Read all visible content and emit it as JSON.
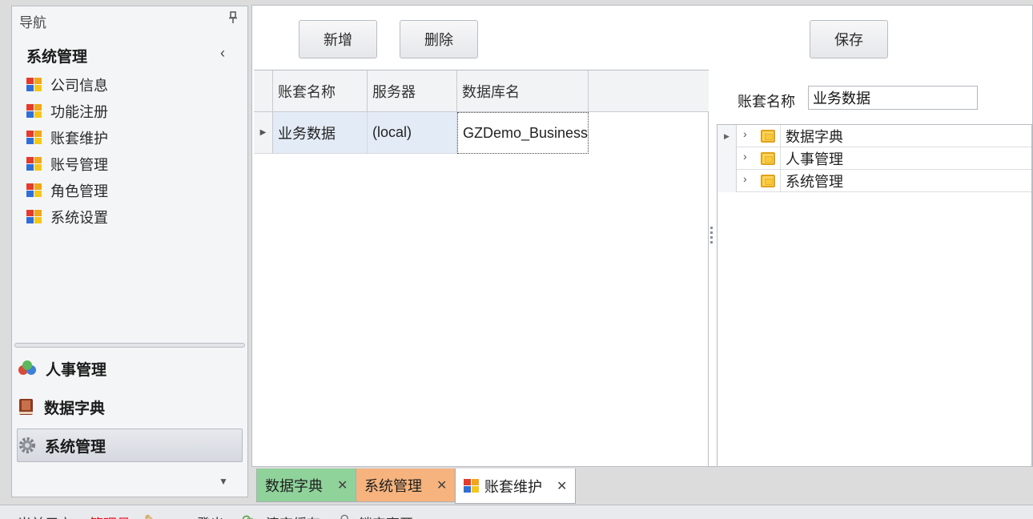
{
  "nav": {
    "title": "导航",
    "group_title": "系统管理",
    "items": [
      {
        "label": "公司信息"
      },
      {
        "label": "功能注册"
      },
      {
        "label": "账套维护"
      },
      {
        "label": "账号管理"
      },
      {
        "label": "角色管理"
      },
      {
        "label": "系统设置"
      }
    ],
    "groups": [
      {
        "label": "人事管理",
        "icon": "people-icon"
      },
      {
        "label": "数据字典",
        "icon": "book-icon"
      },
      {
        "label": "系统管理",
        "icon": "gear-icon",
        "active": true
      }
    ]
  },
  "toolbar": {
    "add_label": "新增",
    "delete_label": "删除",
    "save_label": "保存"
  },
  "grid": {
    "columns": [
      "账套名称",
      "服务器",
      "数据库名"
    ],
    "rows": [
      {
        "name": "业务数据",
        "server": "(local)",
        "database": "GZDemo_Business"
      }
    ]
  },
  "detail": {
    "name_label": "账套名称",
    "name_value": "业务数据",
    "tree": [
      "数据字典",
      "人事管理",
      "系统管理"
    ]
  },
  "tabs": [
    {
      "label": "数据字典",
      "color": "#8fd29a"
    },
    {
      "label": "系统管理",
      "color": "#f6b37e"
    },
    {
      "label": "账套维护",
      "color": "#ffffff",
      "active": true
    }
  ],
  "status": {
    "user_label": "当前用户：",
    "user_name": "管理员",
    "user_color": "#e0121b",
    "exit_label": "EXIT登出",
    "clear_label": "清空缓存",
    "lock_label": "锁定离开"
  }
}
